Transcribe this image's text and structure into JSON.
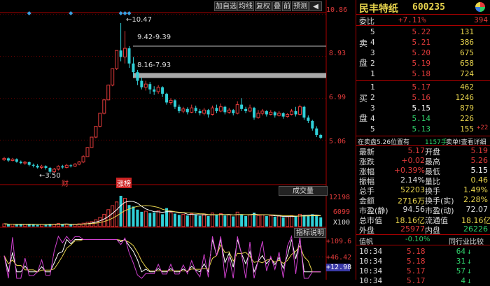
{
  "toolbar": {
    "buttons": [
      "加自选",
      "均线",
      "复权",
      "叠",
      "前",
      "预测"
    ],
    "arrow_label": "◀"
  },
  "price_axis": [
    {
      "label": "10.86",
      "color": "#e23b3b"
    },
    {
      "label": "8.93",
      "color": "#e23b3b"
    },
    {
      "label": "6.99",
      "color": "#e23b3b"
    },
    {
      "label": "5.06",
      "color": "#e23b3b"
    }
  ],
  "annotations": {
    "high_label": "10.47",
    "low_label": "3.50",
    "band1_label": "9.42-9.39",
    "band2_label": "8.16-7.93",
    "marker_cai": "财",
    "marker_zhang": "涨榜"
  },
  "volume_panel": {
    "tab_label": "成交量",
    "axis": [
      {
        "label": "12198",
        "color": "#e23b3b"
      },
      {
        "label": "6099",
        "color": "#e23b3b"
      },
      {
        "label": "X100",
        "color": "#ddd"
      }
    ]
  },
  "indicator_panel": {
    "tab_label": "指标说明",
    "axis": [
      {
        "label": "+109.6",
        "color": "#e23b3b"
      },
      {
        "label": "+46.42",
        "color": "#e23b3b"
      },
      {
        "label": "+12.98",
        "color": "#fff"
      }
    ]
  },
  "stock": {
    "name": "民丰特纸",
    "code": "600235",
    "ratio_label": "委比",
    "ratio_value": "+7.11%",
    "ratio_diff": "394"
  },
  "asks": [
    {
      "level": "5",
      "price": "5.22",
      "volume": "131"
    },
    {
      "level": "4",
      "price": "5.21",
      "volume": "386"
    },
    {
      "level": "3",
      "price": "5.20",
      "volume": "675"
    },
    {
      "level": "2",
      "price": "5.19",
      "volume": "658"
    },
    {
      "level": "1",
      "price": "5.18",
      "volume": "724"
    }
  ],
  "bids": [
    {
      "level": "1",
      "price": "5.17",
      "volume": "462"
    },
    {
      "level": "2",
      "price": "5.16",
      "volume": "1246"
    },
    {
      "level": "3",
      "price": "5.15",
      "volume": "879"
    },
    {
      "level": "4",
      "price": "5.14",
      "volume": "226"
    },
    {
      "level": "5",
      "price": "5.13",
      "volume": "155",
      "extra": "+22"
    }
  ],
  "ask_side_label": [
    "卖",
    "盘"
  ],
  "bid_side_label": [
    "买",
    "盘"
  ],
  "notice": {
    "left": "在卖盘5.26位置有",
    "mid": "1157手",
    "right": "卖单!查看详细"
  },
  "stats": [
    {
      "l1": "最新",
      "v1": "5.17",
      "c1": "#e23b3b",
      "l2": "开盘",
      "v2": "5.19",
      "c2": "#e23b3b"
    },
    {
      "l1": "涨跌",
      "v1": "+0.02",
      "c1": "#e23b3b",
      "l2": "最高",
      "v2": "5.26",
      "c2": "#e23b3b"
    },
    {
      "l1": "涨幅",
      "v1": "+0.39%",
      "c1": "#e23b3b",
      "l2": "最低",
      "v2": "5.15",
      "c2": "#fff"
    },
    {
      "l1": "振幅",
      "v1": "2.14%",
      "c1": "#ddd",
      "l2": "量比",
      "v2": "0.46",
      "c2": "#ddd"
    },
    {
      "l1": "总手",
      "v1": "52203",
      "c1": "#e8d44d",
      "l2": "换手",
      "v2": "1.49%",
      "c2": "#ddd"
    },
    {
      "l1": "金额",
      "v1": "2716万",
      "c1": "#ddd",
      "l2": "换手(实)",
      "v2": "2.28%",
      "c2": "#ddd"
    },
    {
      "l1": "市盈(静)",
      "v1": "94.56",
      "c1": "#ddd",
      "l2": "市盈(动)",
      "v2": "72.07",
      "c2": "#ddd"
    },
    {
      "l1": "总市值",
      "v1": "18.16亿",
      "c1": "#ddd",
      "l2": "流通值",
      "v2": "18.16亿",
      "c2": "#ddd"
    },
    {
      "l1": "外盘",
      "v1": "25977",
      "c1": "#e23b3b",
      "l2": "内盘",
      "v2": "26226",
      "c2": "#2fd06a"
    }
  ],
  "tick_header": {
    "left": "值帆",
    "mid": "-0.10%",
    "right": "同行业比较"
  },
  "ticks": [
    {
      "time": "10:34",
      "price": "5.18",
      "vol": "64",
      "dir": "↓",
      "color": "#2fd06a",
      "pcolor": "#e23b3b"
    },
    {
      "time": "10:34",
      "price": "5.18",
      "vol": "31",
      "dir": "↓",
      "color": "#2fd06a",
      "pcolor": "#e23b3b"
    },
    {
      "time": "10:34",
      "price": "5.17",
      "vol": "57",
      "dir": "↓",
      "color": "#2fd06a",
      "pcolor": "#e23b3b"
    },
    {
      "time": "10:34",
      "price": "5.17",
      "vol": "4",
      "dir": "↓",
      "color": "#2fd06a",
      "pcolor": "#e23b3b"
    }
  ],
  "colors": {
    "up": "#e23b3b",
    "down": "#30d0d8",
    "grid": "#6b0000",
    "ma5": "#ffffff",
    "ma10": "#e8d44d",
    "ma20": "#d040d0"
  },
  "chart_data": {
    "type": "candlestick",
    "price_range": [
      3.2,
      10.95
    ],
    "candles": [
      {
        "o": 4.15,
        "c": 4.22,
        "h": 4.28,
        "l": 4.1
      },
      {
        "o": 4.22,
        "c": 4.12,
        "h": 4.26,
        "l": 4.05
      },
      {
        "o": 4.12,
        "c": 4.18,
        "h": 4.24,
        "l": 4.08
      },
      {
        "o": 4.18,
        "c": 4.06,
        "h": 4.22,
        "l": 4.02
      },
      {
        "o": 4.06,
        "c": 4.0,
        "h": 4.12,
        "l": 3.95
      },
      {
        "o": 4.0,
        "c": 4.04,
        "h": 4.1,
        "l": 3.92
      },
      {
        "o": 4.04,
        "c": 3.92,
        "h": 4.08,
        "l": 3.85
      },
      {
        "o": 3.92,
        "c": 3.88,
        "h": 3.98,
        "l": 3.8
      },
      {
        "o": 3.88,
        "c": 3.8,
        "h": 3.95,
        "l": 3.75
      },
      {
        "o": 3.8,
        "c": 3.86,
        "h": 3.92,
        "l": 3.72
      },
      {
        "o": 3.86,
        "c": 3.78,
        "h": 3.9,
        "l": 3.7
      },
      {
        "o": 3.78,
        "c": 3.6,
        "h": 3.82,
        "l": 3.5
      },
      {
        "o": 3.6,
        "c": 3.72,
        "h": 3.78,
        "l": 3.55
      },
      {
        "o": 3.72,
        "c": 3.85,
        "h": 3.9,
        "l": 3.66
      },
      {
        "o": 3.85,
        "c": 3.8,
        "h": 3.92,
        "l": 3.74
      },
      {
        "o": 3.8,
        "c": 3.9,
        "h": 3.96,
        "l": 3.76
      },
      {
        "o": 3.9,
        "c": 3.86,
        "h": 3.95,
        "l": 3.8
      },
      {
        "o": 3.86,
        "c": 3.95,
        "h": 4.0,
        "l": 3.82
      },
      {
        "o": 3.95,
        "c": 4.05,
        "h": 4.1,
        "l": 3.9
      },
      {
        "o": 4.05,
        "c": 4.3,
        "h": 4.36,
        "l": 4.0
      },
      {
        "o": 4.3,
        "c": 4.72,
        "h": 4.75,
        "l": 4.28
      },
      {
        "o": 4.72,
        "c": 5.2,
        "h": 5.2,
        "l": 4.7
      },
      {
        "o": 5.2,
        "c": 5.7,
        "h": 5.72,
        "l": 5.15
      },
      {
        "o": 5.7,
        "c": 6.3,
        "h": 6.3,
        "l": 5.65
      },
      {
        "o": 6.3,
        "c": 6.92,
        "h": 6.95,
        "l": 6.25
      },
      {
        "o": 6.92,
        "c": 7.6,
        "h": 7.62,
        "l": 6.9
      },
      {
        "o": 7.6,
        "c": 8.36,
        "h": 8.38,
        "l": 7.55
      },
      {
        "o": 8.36,
        "c": 9.2,
        "h": 9.2,
        "l": 8.3
      },
      {
        "o": 9.2,
        "c": 8.9,
        "h": 10.47,
        "l": 8.7
      },
      {
        "o": 8.9,
        "c": 9.3,
        "h": 10.1,
        "l": 8.6
      },
      {
        "o": 9.3,
        "c": 8.6,
        "h": 9.4,
        "l": 8.4
      },
      {
        "o": 8.6,
        "c": 8.2,
        "h": 8.9,
        "l": 8.0
      },
      {
        "o": 8.2,
        "c": 7.8,
        "h": 8.3,
        "l": 7.6
      },
      {
        "o": 7.8,
        "c": 7.5,
        "h": 7.95,
        "l": 7.4
      },
      {
        "o": 7.5,
        "c": 7.65,
        "h": 7.8,
        "l": 7.35
      },
      {
        "o": 7.65,
        "c": 7.4,
        "h": 7.75,
        "l": 7.2
      },
      {
        "o": 7.4,
        "c": 7.3,
        "h": 7.55,
        "l": 7.15
      },
      {
        "o": 7.3,
        "c": 7.5,
        "h": 7.6,
        "l": 7.2
      },
      {
        "o": 7.5,
        "c": 7.2,
        "h": 7.55,
        "l": 7.05
      },
      {
        "o": 7.2,
        "c": 6.8,
        "h": 7.25,
        "l": 6.7
      },
      {
        "o": 6.8,
        "c": 6.9,
        "h": 7.0,
        "l": 6.7
      },
      {
        "o": 6.9,
        "c": 6.6,
        "h": 6.95,
        "l": 6.5
      },
      {
        "o": 6.6,
        "c": 6.4,
        "h": 6.7,
        "l": 6.3
      },
      {
        "o": 6.4,
        "c": 6.5,
        "h": 6.6,
        "l": 6.3
      },
      {
        "o": 6.5,
        "c": 6.35,
        "h": 6.58,
        "l": 6.25
      },
      {
        "o": 6.35,
        "c": 6.55,
        "h": 6.7,
        "l": 6.3
      },
      {
        "o": 6.55,
        "c": 6.4,
        "h": 6.65,
        "l": 6.3
      },
      {
        "o": 6.4,
        "c": 6.3,
        "h": 6.5,
        "l": 6.2
      },
      {
        "o": 6.3,
        "c": 6.45,
        "h": 6.55,
        "l": 6.2
      },
      {
        "o": 6.45,
        "c": 6.25,
        "h": 6.5,
        "l": 6.1
      },
      {
        "o": 6.25,
        "c": 6.55,
        "h": 6.65,
        "l": 6.2
      },
      {
        "o": 6.55,
        "c": 6.4,
        "h": 6.7,
        "l": 6.3
      },
      {
        "o": 6.4,
        "c": 6.6,
        "h": 6.75,
        "l": 6.35
      },
      {
        "o": 6.6,
        "c": 6.35,
        "h": 6.65,
        "l": 6.25
      },
      {
        "o": 6.35,
        "c": 6.45,
        "h": 6.55,
        "l": 6.28
      },
      {
        "o": 6.45,
        "c": 6.3,
        "h": 6.5,
        "l": 6.2
      },
      {
        "o": 6.3,
        "c": 6.7,
        "h": 6.85,
        "l": 6.25
      },
      {
        "o": 6.7,
        "c": 6.5,
        "h": 7.0,
        "l": 6.4
      },
      {
        "o": 6.5,
        "c": 6.4,
        "h": 6.6,
        "l": 6.3
      },
      {
        "o": 6.4,
        "c": 6.55,
        "h": 6.7,
        "l": 6.35
      },
      {
        "o": 6.55,
        "c": 6.1,
        "h": 6.6,
        "l": 6.0
      },
      {
        "o": 6.1,
        "c": 6.3,
        "h": 6.45,
        "l": 6.05
      },
      {
        "o": 6.3,
        "c": 6.4,
        "h": 6.5,
        "l": 6.2
      },
      {
        "o": 6.4,
        "c": 6.25,
        "h": 6.45,
        "l": 6.15
      },
      {
        "o": 6.25,
        "c": 6.35,
        "h": 6.45,
        "l": 6.2
      },
      {
        "o": 6.35,
        "c": 6.2,
        "h": 6.4,
        "l": 6.1
      },
      {
        "o": 6.2,
        "c": 6.3,
        "h": 6.4,
        "l": 6.15
      },
      {
        "o": 6.3,
        "c": 6.15,
        "h": 6.35,
        "l": 6.05
      },
      {
        "o": 6.15,
        "c": 6.25,
        "h": 6.3,
        "l": 6.1
      },
      {
        "o": 6.25,
        "c": 6.4,
        "h": 6.5,
        "l": 6.2
      },
      {
        "o": 6.4,
        "c": 6.25,
        "h": 6.6,
        "l": 6.15
      },
      {
        "o": 6.25,
        "c": 6.6,
        "h": 6.7,
        "l": 6.2
      },
      {
        "o": 6.6,
        "c": 6.1,
        "h": 6.65,
        "l": 6.0
      },
      {
        "o": 6.1,
        "c": 5.95,
        "h": 6.2,
        "l": 5.85
      },
      {
        "o": 5.95,
        "c": 5.6,
        "h": 6.0,
        "l": 5.5
      },
      {
        "o": 5.6,
        "c": 5.3,
        "h": 5.7,
        "l": 5.2
      },
      {
        "o": 5.3,
        "c": 5.17,
        "h": 5.35,
        "l": 5.1
      }
    ],
    "volumes": [
      9,
      7,
      8,
      6,
      8,
      7,
      9,
      6,
      5,
      7,
      6,
      9,
      8,
      10,
      7,
      8,
      6,
      7,
      9,
      11,
      14,
      16,
      22,
      30,
      40,
      55,
      68,
      80,
      100,
      92,
      70,
      65,
      55,
      48,
      50,
      44,
      46,
      52,
      40,
      60,
      45,
      42,
      38,
      40,
      36,
      42,
      38,
      35,
      40,
      34,
      44,
      38,
      42,
      36,
      38,
      33,
      47,
      40,
      34,
      38,
      45,
      36,
      38,
      34,
      35,
      32,
      34,
      30,
      32,
      36,
      34,
      40,
      38,
      36,
      40,
      34,
      30
    ],
    "volume_range": [
      0,
      12198
    ],
    "indicator_range": [
      -20,
      109.6
    ]
  }
}
